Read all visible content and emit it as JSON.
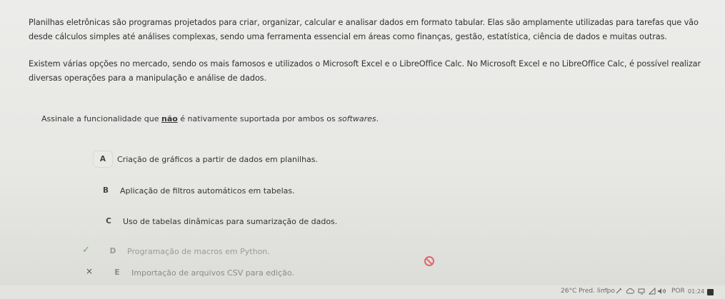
{
  "question": {
    "paragraph1": "Planilhas eletrônicas são programas projetados para criar, organizar, calcular e analisar dados em formato tabular. Elas são amplamente utilizadas para tarefas que vão desde cálculos simples até análises complexas, sendo uma ferramenta essencial em áreas como finanças, gestão, estatística, ciência de dados e muitas outras.",
    "paragraph2": "Existem várias opções no mercado, sendo os mais famosos e utilizados o Microsoft Excel e o LibreOffice Calc. No Microsoft Excel e no LibreOffice Calc, é possível realizar diversas operações para a manipulação e análise de dados.",
    "prompt_before": "Assinale a funcionalidade que ",
    "prompt_emphasis": "não",
    "prompt_middle": " é nativamente suportada por ambos os ",
    "prompt_italic": "softwares",
    "prompt_end": "."
  },
  "options": [
    {
      "letter": "A",
      "text": "Criação de gráficos a partir de dados em planilhas."
    },
    {
      "letter": "B",
      "text": "Aplicação de filtros automáticos em tabelas."
    },
    {
      "letter": "C",
      "text": "Uso de tabelas dinâmicas para sumarização de dados."
    },
    {
      "letter": "D",
      "text": "Programação de macros em Python."
    },
    {
      "letter": "E",
      "text": "Importação de arquivos CSV para edição."
    }
  ],
  "marks": {
    "check": "✓",
    "cross": "×"
  },
  "taskbar": {
    "weather": "26°C  Pred. limpo",
    "tray_arrow": "^",
    "language": "POR",
    "clock": "01:24"
  },
  "colors": {
    "correct": "#6aa86a",
    "ban": "#e0686a"
  }
}
